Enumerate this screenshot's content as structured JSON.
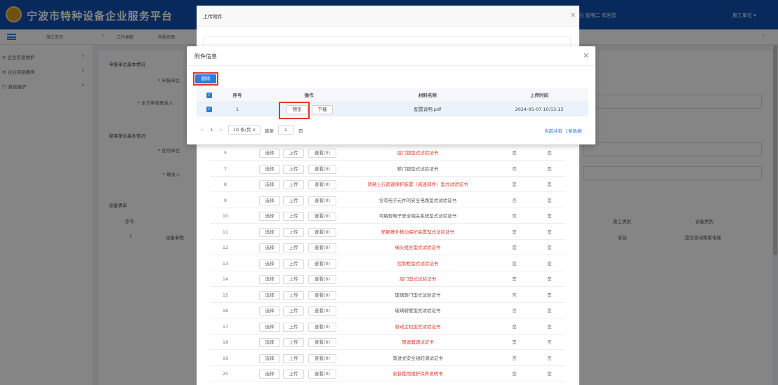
{
  "header": {
    "app_title": "宁波市特种设备企业服务平台",
    "top_right_text": "0日 星期二 欢迎您",
    "unit_menu": "施工单位 ▾"
  },
  "tabs": {
    "items": [
      "施工首页",
      "工作桌面",
      "申报页面"
    ]
  },
  "sidebar": {
    "items": [
      {
        "label": "≡ 企业信息维护"
      },
      {
        "label": "⚙ 企业自助服务"
      },
      {
        "label": "🖵 系统维护"
      }
    ]
  },
  "main": {
    "sections": [
      "申报单位基本情况",
      "使用单位基本情况",
      "设备清单"
    ],
    "fields": [
      "* 申报单位",
      "* 本次申报联系人",
      "* 使用单位",
      "* 联系人"
    ],
    "grid": {
      "seq_header": "序号",
      "row_seq": "1",
      "row_btn": "设备参数",
      "col_construction": "施工类别",
      "col_equipment": "设备类别",
      "val_construction": "安装",
      "val_equipment": "曳引驱动乘客电梯"
    }
  },
  "upload_dialog": {
    "title": "上传附件",
    "btn_select": "选择",
    "btn_upload": "上传",
    "rows": [
      {
        "num": "5",
        "view": "查看(0)",
        "name": "层门锁型式试验证书",
        "red": true,
        "r1": "是",
        "r2": "是"
      },
      {
        "num": "7",
        "view": "查看(0)",
        "name": "轿门锁型式试验证书",
        "red": false,
        "r1": "否",
        "r2": "是"
      },
      {
        "num": "8",
        "view": "查看(0)",
        "name": "轿厢上行超速保护装置（减速部件）型式试验证书",
        "red": true,
        "r1": "是",
        "r2": "是"
      },
      {
        "num": "9",
        "view": "查看(0)",
        "name": "含有电子元件的安全电路型式试验证书",
        "red": false,
        "r1": "否",
        "r2": "是"
      },
      {
        "num": "10",
        "view": "查看(0)",
        "name": "可编程电子安全相关系统型式试验证书",
        "red": false,
        "r1": "否",
        "r2": "是"
      },
      {
        "num": "11",
        "view": "查看(0)",
        "name": "轿厢意外移动保护装置型式试验证书",
        "red": true,
        "r1": "是",
        "r2": "是"
      },
      {
        "num": "12",
        "view": "查看(0)",
        "name": "绳头组合型式试验证书",
        "red": true,
        "r1": "是",
        "r2": "是"
      },
      {
        "num": "13",
        "view": "查看(0)",
        "name": "控制柜型式试验证书",
        "red": true,
        "r1": "是",
        "r2": "是"
      },
      {
        "num": "14",
        "view": "查看(0)",
        "name": "层门型式试验证书",
        "red": true,
        "r1": "是",
        "r2": "是"
      },
      {
        "num": "15",
        "view": "查看(0)",
        "name": "玻璃轿门型式试验证书",
        "red": false,
        "r1": "否",
        "r2": "是"
      },
      {
        "num": "16",
        "view": "查看(0)",
        "name": "玻璃轿壁型式试验证书",
        "red": false,
        "r1": "否",
        "r2": "是"
      },
      {
        "num": "17",
        "view": "查看(0)",
        "name": "驱动主机型式试验证书",
        "red": true,
        "r1": "是",
        "r2": "是"
      },
      {
        "num": "18",
        "view": "查看(0)",
        "name": "限速器调试证书",
        "red": true,
        "r1": "是",
        "r2": "否"
      },
      {
        "num": "19",
        "view": "查看(0)",
        "name": "渐进式安全钳的调试证书",
        "red": false,
        "r1": "否",
        "r2": "否"
      },
      {
        "num": "20",
        "view": "查看(0)",
        "name": "安装使用维护保养说明书",
        "red": true,
        "r1": "是",
        "r2": "是"
      }
    ]
  },
  "attach_modal": {
    "title": "附件信息",
    "delete_label": "删除",
    "columns": {
      "seq": "序号",
      "op": "操作",
      "name": "材料名称",
      "time": "上传时间"
    },
    "row": {
      "seq": "1",
      "preview": "预览",
      "download": "下载",
      "file_name": "配置说明.pdf",
      "upload_time": "2024-05-07 10:53:13"
    },
    "pager": {
      "prev": "<",
      "page": "1",
      "next": ">",
      "page_size": "10 条/页 ∨",
      "jump_label": "跳至",
      "jump_value": "1",
      "page_unit": "页",
      "total_prefix": "当前共有",
      "total_count": "1条数据"
    }
  },
  "colors": {
    "primary": "#2d7be0",
    "header_blue": "#0e4fb0",
    "required_red": "#e0392b"
  }
}
